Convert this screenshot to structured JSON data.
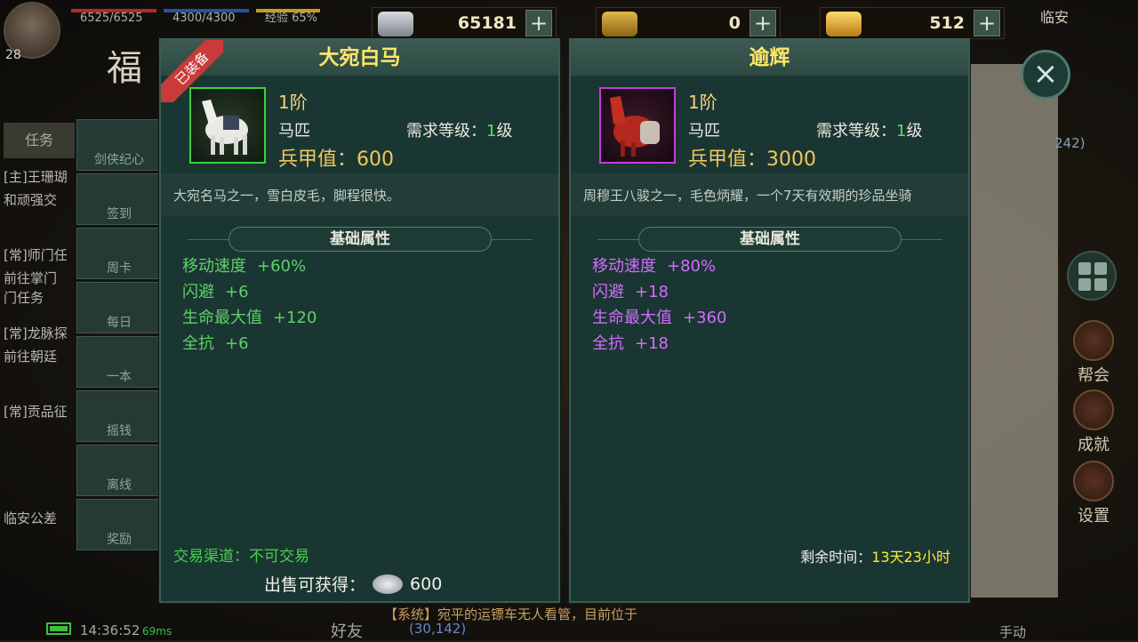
{
  "hud": {
    "hp": "6525/6525",
    "mp": "4300/4300",
    "xp": "经验 65%",
    "level": "28",
    "location": "临安"
  },
  "currencies": {
    "silver": "65181",
    "ticket": "0",
    "gold": "512",
    "plus": "+"
  },
  "quest": {
    "tab": "任务",
    "fu_char": "福",
    "lines": [
      "[主]王珊瑚",
      "和顽强交",
      "[常]师门任",
      "前往掌门",
      "门任务",
      "[常]龙脉探",
      "前往朝廷",
      "[常]贡品征"
    ],
    "location_note": "临安公差"
  },
  "menu": [
    "剑侠纪心",
    "签到",
    "周卡",
    "每日",
    "一本",
    "摇钱",
    "离线",
    "奖励"
  ],
  "side": {
    "guild": "帮会",
    "achievement": "成就",
    "settings": "设置",
    "score": "242)"
  },
  "bottom": {
    "time": "14:36:52",
    "signal": "69ms",
    "friends": "好友",
    "chat": "【系统】宛平的运镖车无人看管，目前位于",
    "coords": "(30,142)",
    "manual": "手动"
  },
  "equipped": {
    "name": "大宛白马",
    "ribbon": "已装备",
    "tier": "1阶",
    "kind": "马匹",
    "req_label": "需求等级：",
    "req_level": "1",
    "req_unit": "级",
    "armor": "兵甲值：600",
    "desc": "大宛名马之一，雪白皮毛，脚程很快。",
    "section": "基础属性",
    "attrs": [
      {
        "name": "移动速度",
        "value": "+60%"
      },
      {
        "name": "闪避",
        "value": "+6"
      },
      {
        "name": "生命最大值",
        "value": "+120"
      },
      {
        "name": "全抗",
        "value": "+6"
      }
    ],
    "trade": "交易渠道：不可交易",
    "sell_label": "出售可获得：",
    "sell_value": "600"
  },
  "compare": {
    "name": "逾辉",
    "tier": "1阶",
    "kind": "马匹",
    "req_label": "需求等级：",
    "req_level": "1",
    "req_unit": "级",
    "armor": "兵甲值：3000",
    "desc": "周穆王八骏之一，毛色炳耀，一个7天有效期的珍品坐骑",
    "section": "基础属性",
    "attrs": [
      {
        "name": "移动速度",
        "value": "+80%"
      },
      {
        "name": "闪避",
        "value": "+18"
      },
      {
        "name": "生命最大值",
        "value": "+360"
      },
      {
        "name": "全抗",
        "value": "+18"
      }
    ],
    "remain_label": "剩余时间：",
    "remain_value": "13天23小时"
  },
  "close": "×"
}
